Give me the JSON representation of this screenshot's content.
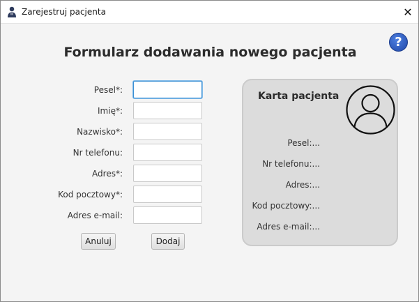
{
  "window": {
    "title": "Zarejestruj pacjenta",
    "close_label": "✕"
  },
  "help": {
    "label": "?"
  },
  "form": {
    "heading": "Formularz dodawania nowego pacjenta",
    "fields": [
      {
        "label": "Pesel*:",
        "value": ""
      },
      {
        "label": "Imię*:",
        "value": ""
      },
      {
        "label": "Nazwisko*:",
        "value": ""
      },
      {
        "label": "Nr telefonu:",
        "value": ""
      },
      {
        "label": "Adres*:",
        "value": ""
      },
      {
        "label": "Kod pocztowy*:",
        "value": ""
      },
      {
        "label": "Adres e-mail:",
        "value": ""
      }
    ],
    "cancel_label": "Anuluj",
    "add_label": "Dodaj"
  },
  "card": {
    "title": "Karta pacjenta",
    "lines": [
      "Pesel:...",
      "Nr telefonu:...",
      "Adres:...",
      "Kod pocztowy:...",
      "Adres e-mail:..."
    ]
  },
  "colors": {
    "background": "#f4f4f4",
    "card_background": "#dcdcdc",
    "focus_border": "#3b8fd4",
    "help_button": "#2a56c6"
  }
}
